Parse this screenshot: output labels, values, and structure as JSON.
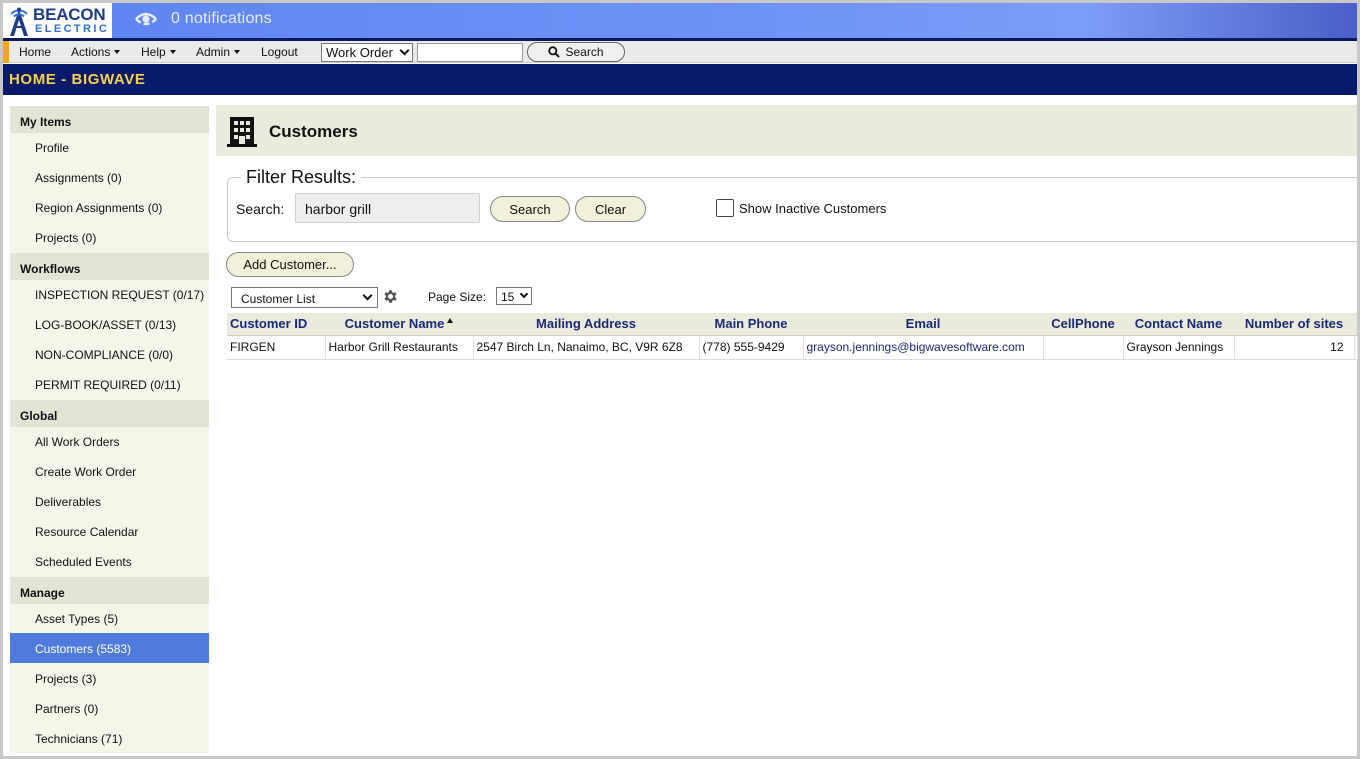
{
  "brand": {
    "line1": "BEACON",
    "line2": "ELECTRIC"
  },
  "notifications": {
    "text": "0 notifications"
  },
  "nav": {
    "home": "Home",
    "actions": "Actions",
    "help": "Help",
    "admin": "Admin",
    "logout": "Logout",
    "search_type": "Work Order",
    "search_value": "",
    "search_button": "Search"
  },
  "title_bar": "HOME - BIGWAVE",
  "sidebar": {
    "sections": [
      {
        "title": "My Items",
        "items": [
          "Profile",
          "Assignments (0)",
          "Region Assignments (0)",
          "Projects (0)"
        ]
      },
      {
        "title": "Workflows",
        "items": [
          "INSPECTION REQUEST (0/17)",
          "LOG-BOOK/ASSET (0/13)",
          "NON-COMPLIANCE (0/0)",
          "PERMIT REQUIRED (0/11)"
        ]
      },
      {
        "title": "Global",
        "items": [
          "All Work Orders",
          "Create Work Order",
          "Deliverables",
          "Resource Calendar",
          "Scheduled Events"
        ]
      },
      {
        "title": "Manage",
        "items": [
          "Asset Types (5)",
          "Customers (5583)",
          "Projects (3)",
          "Partners (0)",
          "Technicians (71)"
        ]
      }
    ],
    "active_item": "Customers (5583)"
  },
  "page": {
    "title": "Customers"
  },
  "filter": {
    "legend": "Filter Results:",
    "search_label": "Search:",
    "search_value": "harbor grill",
    "search_button": "Search",
    "clear_button": "Clear",
    "inactive_label": "Show Inactive Customers",
    "inactive_checked": false
  },
  "add_customer_button": "Add Customer...",
  "grid_view": {
    "selected": "Customer List",
    "page_size_label": "Page Size:",
    "page_size": "15"
  },
  "table": {
    "columns": [
      "Customer ID",
      "Customer Name",
      "Mailing Address",
      "Main Phone",
      "Email",
      "CellPhone",
      "Contact Name",
      "Number of sites"
    ],
    "sorted_column": "Customer Name",
    "rows": [
      [
        "FIRGEN",
        "Harbor Grill Restaurants",
        "2547 Birch Ln, Nanaimo, BC, V9R 6Z8",
        "(778) 555-9429",
        "grayson.jennings@bigwavesoftware.com",
        "",
        "Grayson Jennings",
        "12"
      ]
    ]
  },
  "colors": {
    "accent_blue": "#4f7cdc",
    "title_bar": "#0a1a6b",
    "title_text": "#f6d24a",
    "header_blue": "#6e93f7"
  }
}
